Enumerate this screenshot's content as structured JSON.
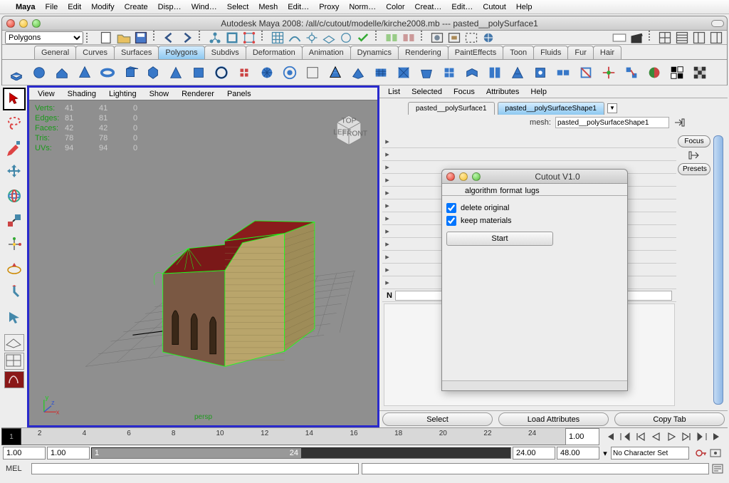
{
  "mac_menu": [
    "Maya",
    "File",
    "Edit",
    "Modify",
    "Create",
    "Disp…",
    "Wind…",
    "Select",
    "Mesh",
    "Edit…",
    "Proxy",
    "Norm…",
    "Color",
    "Creat…",
    "Edit…",
    "Cutout",
    "Help"
  ],
  "window_title": "Autodesk Maya 2008: /all/c/cutout/modelle/kirche2008.mb  ---  pasted__polySurface1",
  "module_selector": "Polygons",
  "shelf_tabs": [
    "General",
    "Curves",
    "Surfaces",
    "Polygons",
    "Subdivs",
    "Deformation",
    "Animation",
    "Dynamics",
    "Rendering",
    "PaintEffects",
    "Toon",
    "Fluids",
    "Fur",
    "Hair"
  ],
  "shelf_active": 3,
  "viewport_menu": [
    "View",
    "Shading",
    "Lighting",
    "Show",
    "Renderer",
    "Panels"
  ],
  "hud": {
    "verts": {
      "a": "41",
      "b": "41",
      "c": "0"
    },
    "edges": {
      "a": "81",
      "b": "81",
      "c": "0"
    },
    "faces": {
      "a": "42",
      "b": "42",
      "c": "0"
    },
    "tris": {
      "a": "78",
      "b": "78",
      "c": "0"
    },
    "uvs": {
      "a": "94",
      "b": "94",
      "c": "0"
    }
  },
  "persp_label": "persp",
  "attr_menu": [
    "List",
    "Selected",
    "Focus",
    "Attributes",
    "Help"
  ],
  "attr_tabs": {
    "items": [
      "pasted__polySurface1",
      "pasted__polySurfaceShape1"
    ],
    "active": 1
  },
  "mesh_label": "mesh:",
  "mesh_value": "pasted__polySurfaceShape1",
  "focus_btn": "Focus",
  "presets_btn": "Presets",
  "n_label": "N",
  "attr_footer": [
    "Select",
    "Load Attributes",
    "Copy Tab"
  ],
  "dialog": {
    "title": "Cutout V1.0",
    "tabs": [
      "algorithm",
      "format",
      "lugs"
    ],
    "active": 0,
    "opt1": "delete original",
    "opt2": "keep materials",
    "start": "Start"
  },
  "timeline": {
    "cur_frame_box": "1",
    "ticks": [
      "2",
      "4",
      "6",
      "8",
      "10",
      "12",
      "14",
      "16",
      "18",
      "20",
      "22",
      "24"
    ],
    "cur_frame": "1.00",
    "range_start_outer": "1.00",
    "range_start_inner": "1.00",
    "range_end_inner": "24.00",
    "range_end_outer": "48.00",
    "slider_start": "1",
    "slider_end": "24",
    "charset": "No Character Set",
    "cmd_label": "MEL"
  }
}
